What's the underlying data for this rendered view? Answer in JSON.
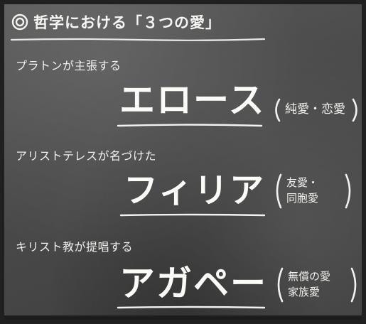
{
  "title": "哲学における「３つの愛」",
  "sections": [
    {
      "label": "プラトンが主張する",
      "term": "エロース",
      "meaning": [
        "純愛・恋愛"
      ]
    },
    {
      "label": "アリストテレスが名づけた",
      "term": "フィリア",
      "meaning": [
        "友愛・",
        "同胞愛"
      ]
    },
    {
      "label": "キリスト教が提唱する",
      "term": "アガペー",
      "meaning": [
        "無償の愛",
        "家族愛"
      ]
    }
  ],
  "colors": {
    "chalk": "#f2f2ef",
    "board": "#4b4b4b"
  },
  "icons": {
    "title_bullet": "double-circle-icon"
  }
}
